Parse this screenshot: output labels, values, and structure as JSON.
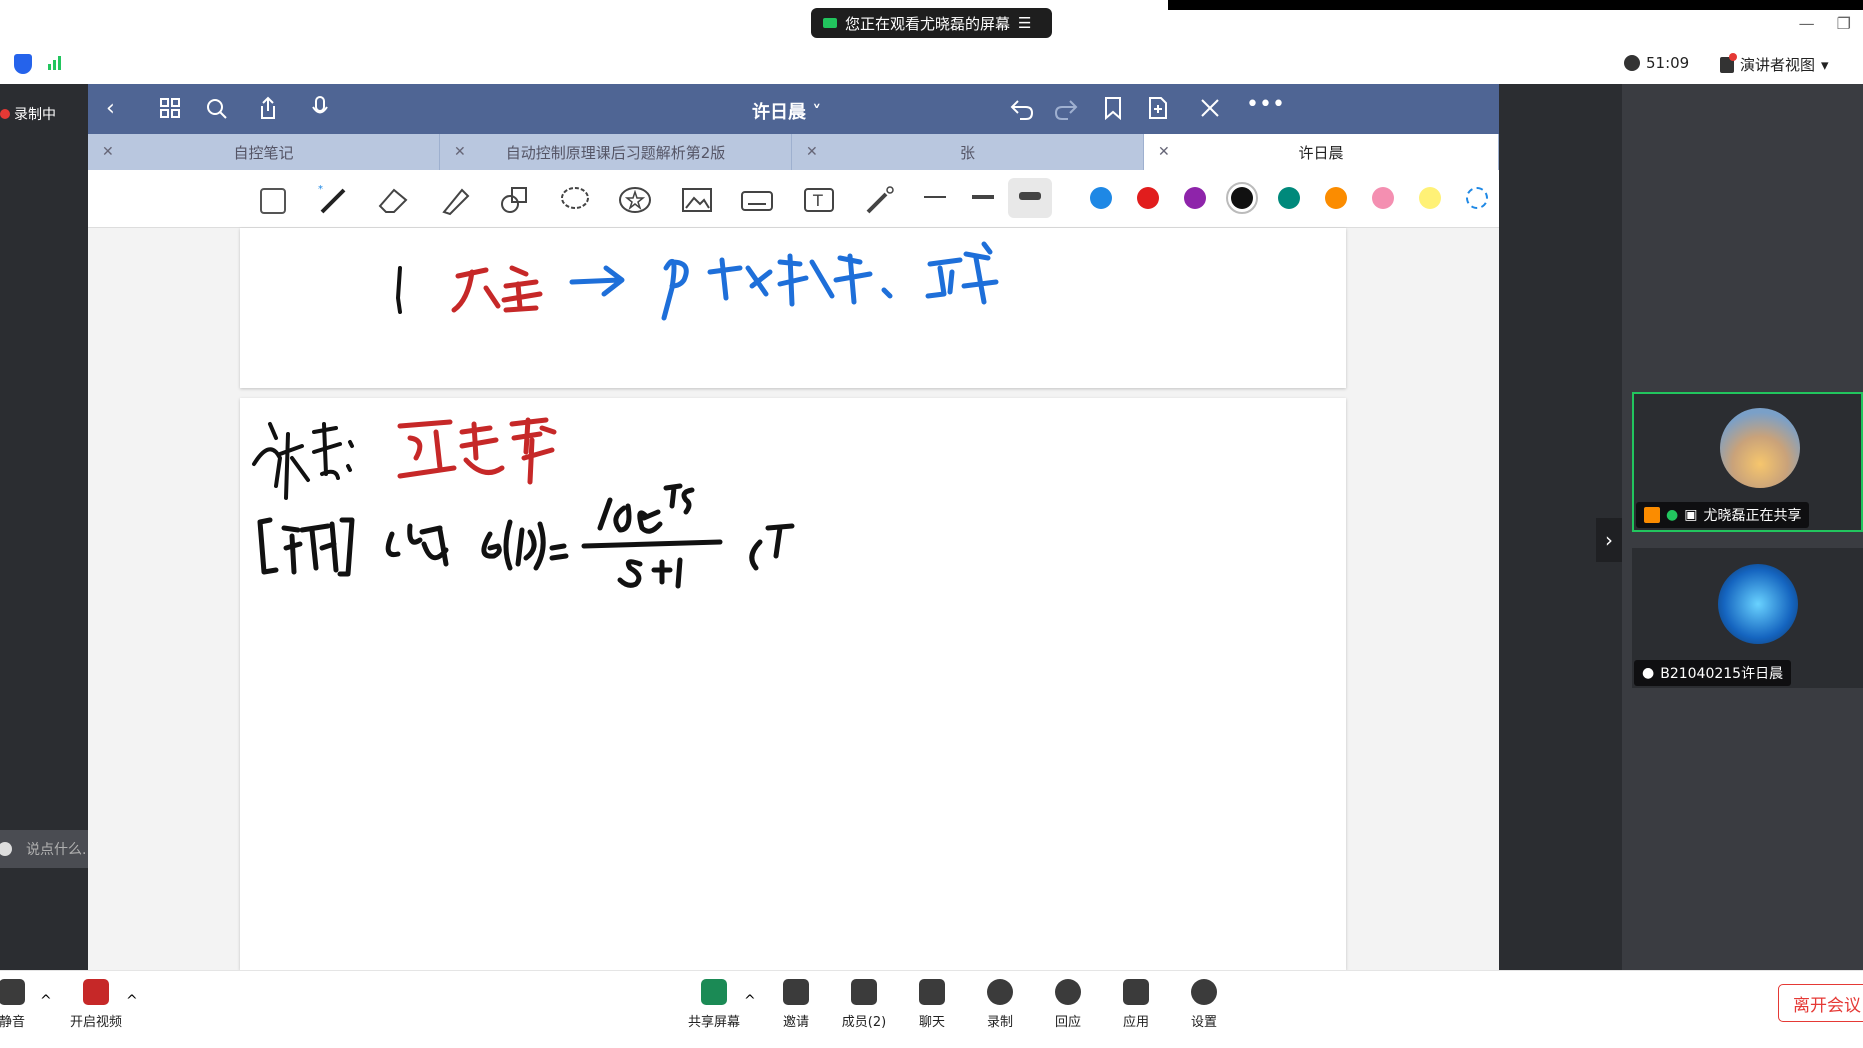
{
  "topbar": {
    "share_banner": "您正在观看尤晓磊的屏幕",
    "timer": "51:09",
    "view_label": "演讲者视图"
  },
  "left": {
    "recording_label": "录制中",
    "chat_placeholder": "说点什么..."
  },
  "app": {
    "doc_title": "许日晨 ˅",
    "tabs": [
      {
        "label": "自控笔记"
      },
      {
        "label": "自动控制原理课后习题解析第2版"
      },
      {
        "label": "张"
      },
      {
        "label": "许日晨"
      }
    ],
    "colors": [
      "#1e88e5",
      "#e11d1d",
      "#8e24aa",
      "#111111",
      "#00897b",
      "#fb8c00",
      "#f48fb1",
      "#fff176"
    ],
    "selected_color": "#111111"
  },
  "participants": [
    {
      "name": "尤晓磊正在共享"
    },
    {
      "name": "B21040215许日晨"
    }
  ],
  "bottombar": {
    "items": [
      {
        "label": "静音",
        "icon": "mic-icon"
      },
      {
        "label": "开启视频",
        "icon": "video-off-icon"
      },
      {
        "label": "共享屏幕",
        "icon": "share-screen-icon"
      },
      {
        "label": "邀请",
        "icon": "invite-icon"
      },
      {
        "label": "成员(2)",
        "icon": "members-icon"
      },
      {
        "label": "聊天",
        "icon": "chat-icon"
      },
      {
        "label": "录制",
        "icon": "record-icon"
      },
      {
        "label": "回应",
        "icon": "reaction-icon"
      },
      {
        "label": "应用",
        "icon": "apps-icon"
      },
      {
        "label": "设置",
        "icon": "gear-icon"
      }
    ],
    "leave_label": "离开会议"
  }
}
